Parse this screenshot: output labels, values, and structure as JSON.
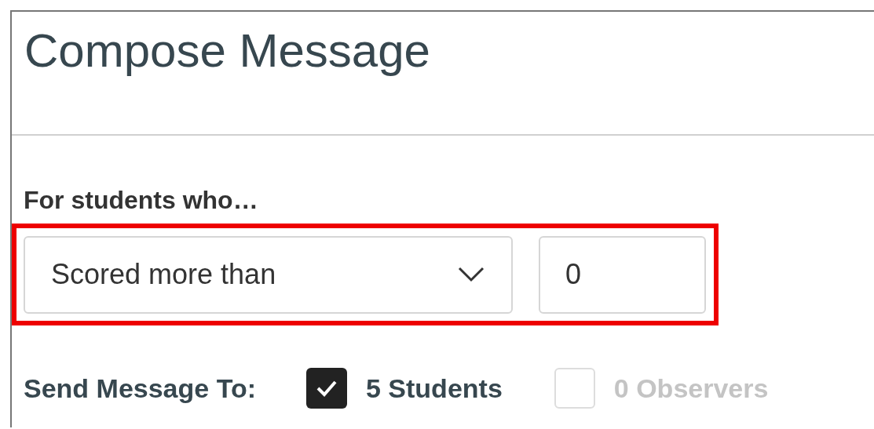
{
  "title": "Compose Message",
  "criteria": {
    "label": "For students who…",
    "condition": "Scored more than",
    "value": "0"
  },
  "recipients": {
    "label": "Send Message To:",
    "options": [
      {
        "label": "5 Students",
        "checked": true,
        "disabled": false
      },
      {
        "label": "0 Observers",
        "checked": false,
        "disabled": true
      }
    ]
  }
}
